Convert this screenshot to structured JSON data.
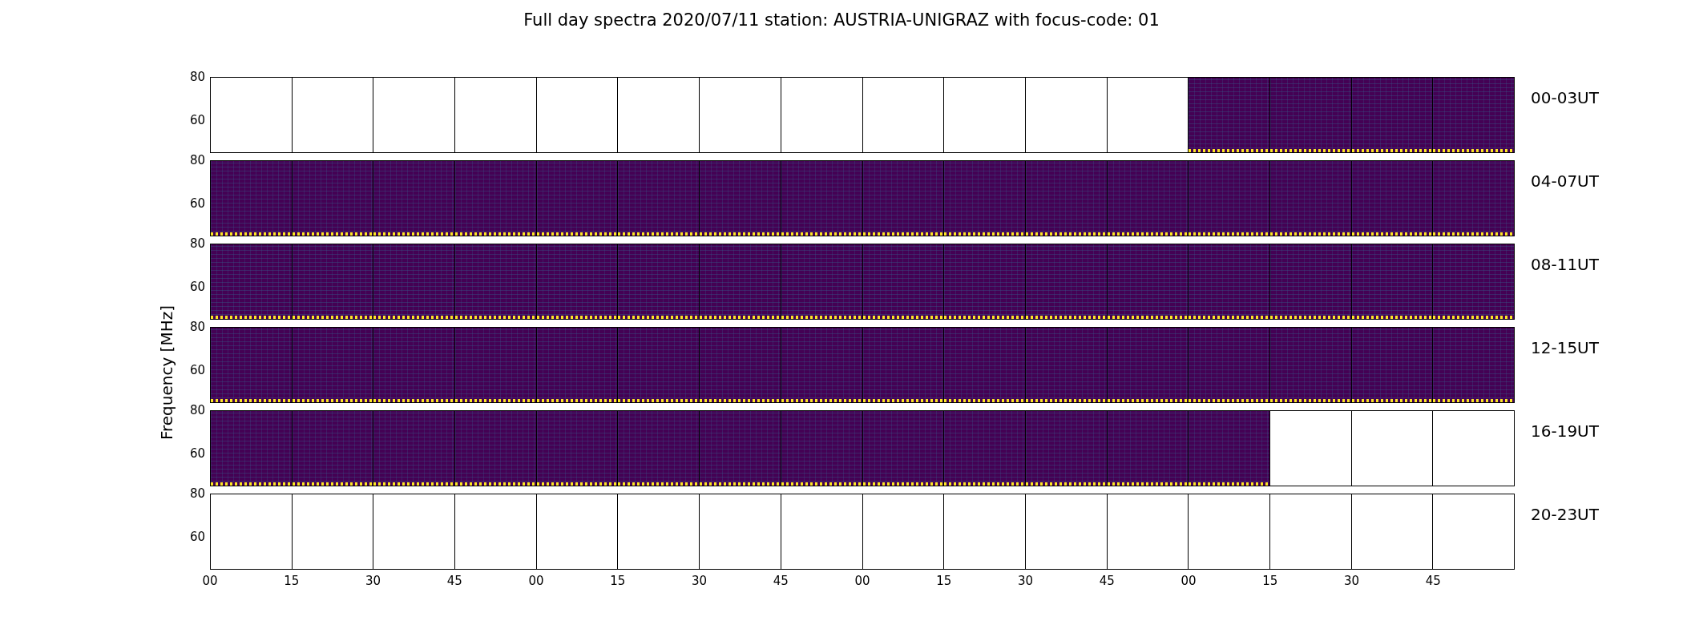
{
  "title": "Full day spectra 2020/07/11 station: AUSTRIA-UNIGRAZ with focus-code: 01",
  "ylabel": "Frequency [MHz]",
  "rows": [
    {
      "label": "00-03UT",
      "yticks": [
        "80",
        "60"
      ],
      "panels": [
        {
          "kind": "empty"
        },
        {
          "kind": "empty"
        },
        {
          "kind": "empty"
        },
        {
          "kind": "empty"
        },
        {
          "kind": "empty"
        },
        {
          "kind": "empty"
        },
        {
          "kind": "empty"
        },
        {
          "kind": "empty"
        },
        {
          "kind": "empty"
        },
        {
          "kind": "empty"
        },
        {
          "kind": "empty"
        },
        {
          "kind": "empty"
        },
        {
          "kind": "spectrum"
        },
        {
          "kind": "spectrum"
        },
        {
          "kind": "spectrum"
        },
        {
          "kind": "spectrum"
        }
      ]
    },
    {
      "label": "04-07UT",
      "yticks": [
        "80",
        "60"
      ],
      "panels": [
        {
          "kind": "spectrum"
        },
        {
          "kind": "spectrum"
        },
        {
          "kind": "spectrum"
        },
        {
          "kind": "spectrum"
        },
        {
          "kind": "spectrum"
        },
        {
          "kind": "spectrum"
        },
        {
          "kind": "spectrum"
        },
        {
          "kind": "spectrum"
        },
        {
          "kind": "spectrum"
        },
        {
          "kind": "spectrum"
        },
        {
          "kind": "spectrum"
        },
        {
          "kind": "spectrum"
        },
        {
          "kind": "spectrum"
        },
        {
          "kind": "spectrum"
        },
        {
          "kind": "spectrum"
        },
        {
          "kind": "spectrum"
        }
      ]
    },
    {
      "label": "08-11UT",
      "yticks": [
        "80",
        "60"
      ],
      "panels": [
        {
          "kind": "spectrum"
        },
        {
          "kind": "spectrum"
        },
        {
          "kind": "spectrum"
        },
        {
          "kind": "spectrum"
        },
        {
          "kind": "spectrum"
        },
        {
          "kind": "spectrum"
        },
        {
          "kind": "spectrum"
        },
        {
          "kind": "spectrum"
        },
        {
          "kind": "spectrum"
        },
        {
          "kind": "spectrum"
        },
        {
          "kind": "spectrum"
        },
        {
          "kind": "spectrum"
        },
        {
          "kind": "spectrum"
        },
        {
          "kind": "spectrum"
        },
        {
          "kind": "spectrum"
        },
        {
          "kind": "spectrum"
        }
      ]
    },
    {
      "label": "12-15UT",
      "yticks": [
        "80",
        "60"
      ],
      "panels": [
        {
          "kind": "spectrum"
        },
        {
          "kind": "spectrum"
        },
        {
          "kind": "spectrum"
        },
        {
          "kind": "spectrum"
        },
        {
          "kind": "spectrum"
        },
        {
          "kind": "spectrum"
        },
        {
          "kind": "spectrum"
        },
        {
          "kind": "spectrum"
        },
        {
          "kind": "spectrum"
        },
        {
          "kind": "spectrum"
        },
        {
          "kind": "spectrum"
        },
        {
          "kind": "spectrum"
        },
        {
          "kind": "spectrum"
        },
        {
          "kind": "spectrum"
        },
        {
          "kind": "spectrum"
        },
        {
          "kind": "spectrum"
        }
      ]
    },
    {
      "label": "16-19UT",
      "yticks": [
        "80",
        "60"
      ],
      "panels": [
        {
          "kind": "spectrum"
        },
        {
          "kind": "spectrum"
        },
        {
          "kind": "spectrum"
        },
        {
          "kind": "spectrum"
        },
        {
          "kind": "spectrum"
        },
        {
          "kind": "spectrum"
        },
        {
          "kind": "spectrum"
        },
        {
          "kind": "spectrum"
        },
        {
          "kind": "spectrum"
        },
        {
          "kind": "spectrum"
        },
        {
          "kind": "spectrum"
        },
        {
          "kind": "spectrum"
        },
        {
          "kind": "spectrum"
        },
        {
          "kind": "empty"
        },
        {
          "kind": "empty"
        },
        {
          "kind": "empty"
        }
      ]
    },
    {
      "label": "20-23UT",
      "yticks": [
        "80",
        "60"
      ],
      "panels": [
        {
          "kind": "empty"
        },
        {
          "kind": "empty"
        },
        {
          "kind": "empty"
        },
        {
          "kind": "empty"
        },
        {
          "kind": "empty"
        },
        {
          "kind": "empty"
        },
        {
          "kind": "empty"
        },
        {
          "kind": "empty"
        },
        {
          "kind": "empty"
        },
        {
          "kind": "empty"
        },
        {
          "kind": "empty"
        },
        {
          "kind": "empty"
        },
        {
          "kind": "empty"
        },
        {
          "kind": "empty"
        },
        {
          "kind": "empty"
        },
        {
          "kind": "empty"
        }
      ]
    }
  ],
  "xticks": [
    "00",
    "15",
    "30",
    "45",
    "00",
    "15",
    "30",
    "45",
    "00",
    "15",
    "30",
    "45",
    "00",
    "15",
    "30",
    "45"
  ]
}
